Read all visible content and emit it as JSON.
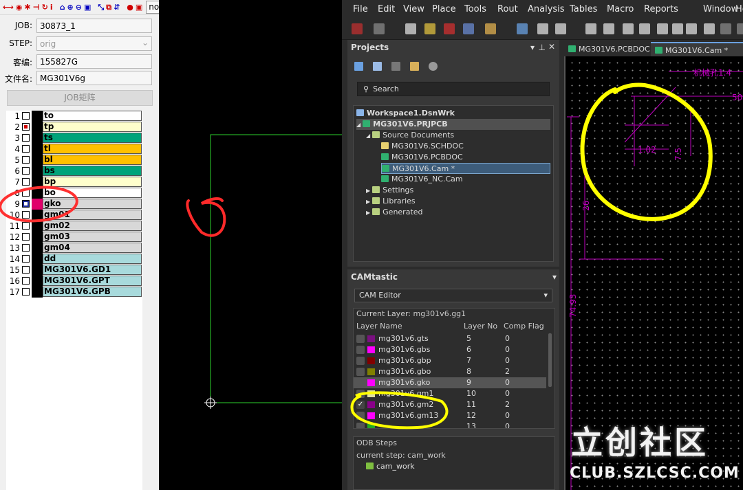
{
  "left_toolbar": {
    "icons": [
      "fit-h-icon",
      "eye-icon",
      "snap-icon",
      "measure-icon",
      "rotate-icon",
      "info-icon",
      "home-icon",
      "zoom-in-icon",
      "zoom-out-icon",
      "edit-icon",
      "cross-icon",
      "window-icon",
      "flip-icon",
      "pen-icon",
      "layer-icon"
    ],
    "dropdown_value": "none"
  },
  "job_form": {
    "job_label": "JOB:",
    "job_value": "30873_1",
    "step_label": "STEP:",
    "step_value": "orig",
    "customer_label": "客编:",
    "customer_value": "155827G",
    "filename_label": "文件名:",
    "filename_value": "MG301V6g",
    "matrix_button": "JOB矩阵"
  },
  "layers": [
    {
      "num": "1",
      "name": "to",
      "color": "#ffffff",
      "box": "#fff"
    },
    {
      "num": "2",
      "name": "tp",
      "color": "#ffffcc",
      "box": "#d00000"
    },
    {
      "num": "3",
      "name": "ts",
      "color": "#00a37a",
      "box": "#fff"
    },
    {
      "num": "4",
      "name": "tl",
      "color": "#ffc000",
      "box": "#fff"
    },
    {
      "num": "5",
      "name": "bl",
      "color": "#ffc000",
      "box": "#fff"
    },
    {
      "num": "6",
      "name": "bs",
      "color": "#00a37a",
      "box": "#fff"
    },
    {
      "num": "7",
      "name": "bp",
      "color": "#ffffcc",
      "box": "#fff"
    },
    {
      "num": "8",
      "name": "bo",
      "color": "#ffffff",
      "box": "#fff"
    },
    {
      "num": "9",
      "name": "gko",
      "color": "#d8d8d8",
      "box": "#fff"
    },
    {
      "num": "10",
      "name": "gm01",
      "color": "#d8d8d8",
      "box": "#fff"
    },
    {
      "num": "11",
      "name": "gm02",
      "color": "#d8d8d8",
      "box": "#fff"
    },
    {
      "num": "12",
      "name": "gm03",
      "color": "#d8d8d8",
      "box": "#fff"
    },
    {
      "num": "13",
      "name": "gm04",
      "color": "#d8d8d8",
      "box": "#fff"
    },
    {
      "num": "14",
      "name": "dd",
      "color": "#a8dadc",
      "box": "#fff"
    },
    {
      "num": "15",
      "name": "MG301V6.GD1",
      "color": "#a8dadc",
      "box": "#fff"
    },
    {
      "num": "16",
      "name": "MG301V6.GPT",
      "color": "#a8dadc",
      "box": "#fff"
    },
    {
      "num": "17",
      "name": "MG301V6.GPB",
      "color": "#a8dadc",
      "box": "#fff"
    }
  ],
  "menu": [
    "File",
    "Edit",
    "View",
    "Place",
    "Tools",
    "Rout",
    "Analysis",
    "Tables",
    "Macro",
    "Reports",
    "Window",
    "Hel"
  ],
  "projects": {
    "title": "Projects",
    "pin_icons": [
      "▾",
      "⊿",
      "✕"
    ],
    "search_placeholder": "Search",
    "workspace": "Workspace1.DsnWrk",
    "project": "MG301V6.PRJPCB",
    "source_docs": "Source Documents",
    "docs": [
      "MG301V6.SCHDOC",
      "MG301V6.PCBDOC",
      "MG301V6.Cam *",
      "MG301V6_NC.Cam"
    ],
    "folders": [
      "Settings",
      "Libraries",
      "Generated"
    ]
  },
  "camtastic": {
    "title": "CAMtastic",
    "editor": "CAM Editor",
    "current_layer": "Current Layer: mg301v6.gg1",
    "col_name": "Layer Name",
    "col_no": "Layer No",
    "col_flag": "Comp Flag",
    "rows": [
      {
        "name": "mg301v6.gts",
        "no": "5",
        "flag": "0",
        "color": "#7a1080",
        "checked": false
      },
      {
        "name": "mg301v6.gbs",
        "no": "6",
        "flag": "0",
        "color": "#ff00ff",
        "checked": false
      },
      {
        "name": "mg301v6.gbp",
        "no": "7",
        "flag": "0",
        "color": "#800000",
        "checked": false
      },
      {
        "name": "mg301v6.gbo",
        "no": "8",
        "flag": "2",
        "color": "#808000",
        "checked": false
      },
      {
        "name": "mg301v6.gko",
        "no": "9",
        "flag": "0",
        "color": "#ff00ff",
        "checked": false
      },
      {
        "name": "mg301v6.gm1",
        "no": "10",
        "flag": "0",
        "color": "#e0e0a0",
        "checked": false
      },
      {
        "name": "mg301v6.gm2",
        "no": "11",
        "flag": "2",
        "color": "#8a008a",
        "checked": true
      },
      {
        "name": "mg301v6.gm13",
        "no": "12",
        "flag": "0",
        "color": "#ff00ff",
        "checked": false
      },
      {
        "name": "",
        "no": "13",
        "flag": "0",
        "color": "#22aa22",
        "checked": false
      }
    ],
    "odb_title": "ODB Steps",
    "current_step": "current step: cam_work",
    "step": "cam_work"
  },
  "doc_tabs": [
    "MG301V6.PCBDOC",
    "MG301V6.Cam *"
  ],
  "pcb_labels": {
    "top": "机械孔1.4",
    "dim50": "50",
    "dim102": "1.02",
    "dim75": "7.5",
    "dim26": "26",
    "dim7493": "74.93"
  },
  "watermark": {
    "line1": "立创社区",
    "line2": "CLUB.SZLCSC.COM"
  }
}
